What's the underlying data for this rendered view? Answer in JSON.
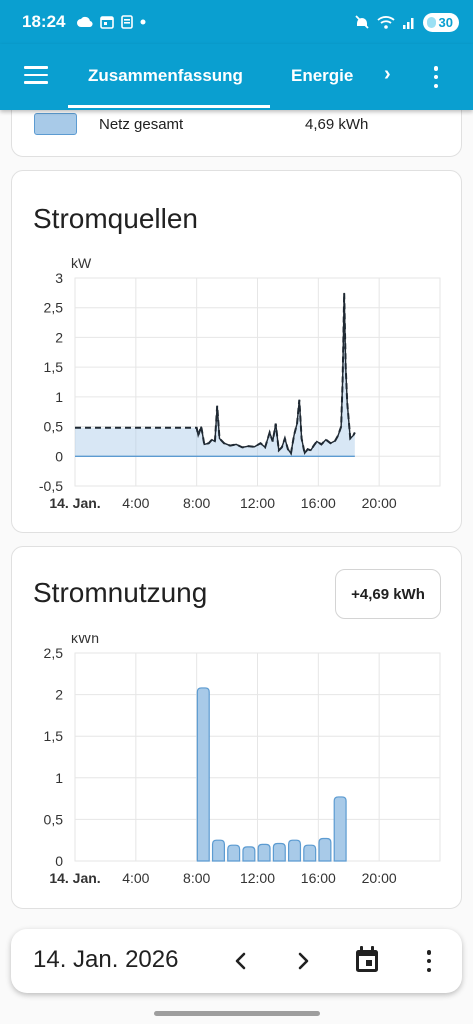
{
  "status_bar": {
    "time": "18:24",
    "battery": "30"
  },
  "toolbar": {
    "tabs": [
      {
        "label": "Zusammenfassung",
        "active": true
      },
      {
        "label": "Energie",
        "active": false
      }
    ],
    "accent_color": "#0a9fd0"
  },
  "summary_row": {
    "label": "Netz gesamt",
    "value": "4,69 kWh",
    "swatch_color": "#a8cae8"
  },
  "stromquellen": {
    "title": "Stromquellen",
    "chart_data": {
      "type": "line",
      "unit": "kW",
      "y_ticks": [
        "3",
        "2,5",
        "2",
        "1,5",
        "1",
        "0,5",
        "0",
        "-0,5"
      ],
      "x_ticks": [
        "14. Jan.",
        "4:00",
        "8:00",
        "12:00",
        "16:00",
        "20:00"
      ],
      "ylim": [
        -0.5,
        3
      ],
      "xlim": [
        0,
        24
      ],
      "grid": true,
      "series": [
        {
          "style": "dashed",
          "color": "#1f2933",
          "fill": "#a8cae8",
          "points": [
            [
              0,
              0.48
            ],
            [
              8.0,
              0.48
            ],
            [
              8.1,
              0.35
            ],
            [
              8.3,
              0.5
            ],
            [
              8.5,
              0.2
            ],
            [
              8.8,
              0.22
            ],
            [
              9.0,
              0.28
            ],
            [
              9.2,
              0.25
            ],
            [
              9.35,
              0.85
            ],
            [
              9.5,
              0.3
            ],
            [
              9.8,
              0.22
            ],
            [
              10.2,
              0.18
            ],
            [
              10.6,
              0.2
            ],
            [
              11.0,
              0.15
            ],
            [
              11.4,
              0.17
            ],
            [
              11.8,
              0.16
            ],
            [
              12.2,
              0.22
            ],
            [
              12.5,
              0.15
            ],
            [
              12.8,
              0.4
            ],
            [
              13.0,
              0.25
            ],
            [
              13.2,
              0.55
            ],
            [
              13.4,
              0.1
            ],
            [
              13.6,
              0.15
            ],
            [
              13.8,
              0.3
            ],
            [
              14.0,
              0.12
            ],
            [
              14.2,
              0.05
            ],
            [
              14.4,
              0.35
            ],
            [
              14.6,
              0.55
            ],
            [
              14.75,
              0.95
            ],
            [
              14.9,
              0.3
            ],
            [
              15.1,
              0.05
            ],
            [
              15.3,
              0.12
            ],
            [
              15.5,
              0.1
            ],
            [
              15.7,
              0.18
            ],
            [
              15.9,
              0.25
            ],
            [
              16.2,
              0.2
            ],
            [
              16.5,
              0.28
            ],
            [
              16.8,
              0.22
            ],
            [
              17.1,
              0.26
            ],
            [
              17.3,
              0.35
            ],
            [
              17.5,
              0.5
            ],
            [
              17.6,
              1.3
            ],
            [
              17.7,
              2.75
            ],
            [
              17.8,
              1.5
            ],
            [
              17.9,
              0.9
            ],
            [
              18.0,
              0.6
            ],
            [
              18.1,
              0.3
            ],
            [
              18.3,
              0.35
            ],
            [
              18.4,
              0.4
            ]
          ]
        },
        {
          "style": "solid",
          "color": "#1f2933",
          "points": [
            [
              8.0,
              0.48
            ],
            [
              8.1,
              0.35
            ],
            [
              8.3,
              0.5
            ],
            [
              8.5,
              0.2
            ],
            [
              8.8,
              0.22
            ],
            [
              9.0,
              0.28
            ],
            [
              9.2,
              0.25
            ],
            [
              9.35,
              0.85
            ],
            [
              9.5,
              0.3
            ],
            [
              9.8,
              0.22
            ],
            [
              10.2,
              0.18
            ],
            [
              10.6,
              0.2
            ],
            [
              11.0,
              0.15
            ],
            [
              11.4,
              0.17
            ],
            [
              11.8,
              0.16
            ],
            [
              12.2,
              0.22
            ],
            [
              12.5,
              0.15
            ],
            [
              12.8,
              0.4
            ],
            [
              13.0,
              0.25
            ],
            [
              13.2,
              0.55
            ],
            [
              13.4,
              0.1
            ],
            [
              13.6,
              0.15
            ],
            [
              13.8,
              0.3
            ],
            [
              14.0,
              0.12
            ],
            [
              14.2,
              0.05
            ],
            [
              14.4,
              0.35
            ],
            [
              14.6,
              0.55
            ],
            [
              14.75,
              0.95
            ],
            [
              14.9,
              0.3
            ],
            [
              15.1,
              0.05
            ],
            [
              15.3,
              0.12
            ],
            [
              15.5,
              0.1
            ],
            [
              15.7,
              0.18
            ],
            [
              15.9,
              0.25
            ],
            [
              16.2,
              0.2
            ],
            [
              16.5,
              0.28
            ],
            [
              16.8,
              0.22
            ],
            [
              17.1,
              0.26
            ],
            [
              17.3,
              0.35
            ],
            [
              17.5,
              0.5
            ],
            [
              17.6,
              1.3
            ],
            [
              17.7,
              2.75
            ],
            [
              17.8,
              1.5
            ],
            [
              17.9,
              0.9
            ],
            [
              18.0,
              0.6
            ],
            [
              18.1,
              0.3
            ],
            [
              18.3,
              0.35
            ],
            [
              18.4,
              0.4
            ]
          ]
        },
        {
          "style": "solid",
          "color": "#5c9bd1",
          "points": [
            [
              0,
              0
            ],
            [
              18.4,
              0
            ]
          ]
        }
      ]
    }
  },
  "stromnutzung": {
    "title": "Stromnutzung",
    "total": "+4,69 kWh",
    "chart_data": {
      "type": "bar",
      "unit": "kWh",
      "y_ticks": [
        "2,5",
        "2",
        "1,5",
        "1",
        "0,5",
        "0"
      ],
      "x_ticks": [
        "14. Jan.",
        "4:00",
        "8:00",
        "12:00",
        "16:00",
        "20:00"
      ],
      "ylim": [
        0,
        2.5
      ],
      "xlim": [
        0,
        24
      ],
      "grid": true,
      "bar_color": "#a8cae8",
      "bar_border": "#5c9bd1",
      "categories": [
        "8:00",
        "9:00",
        "10:00",
        "11:00",
        "12:00",
        "13:00",
        "14:00",
        "15:00",
        "16:00",
        "17:00"
      ],
      "values": [
        2.08,
        0.25,
        0.19,
        0.17,
        0.2,
        0.21,
        0.25,
        0.19,
        0.27,
        0.77
      ]
    }
  },
  "datebar": {
    "date": "14. Jan. 2026"
  }
}
